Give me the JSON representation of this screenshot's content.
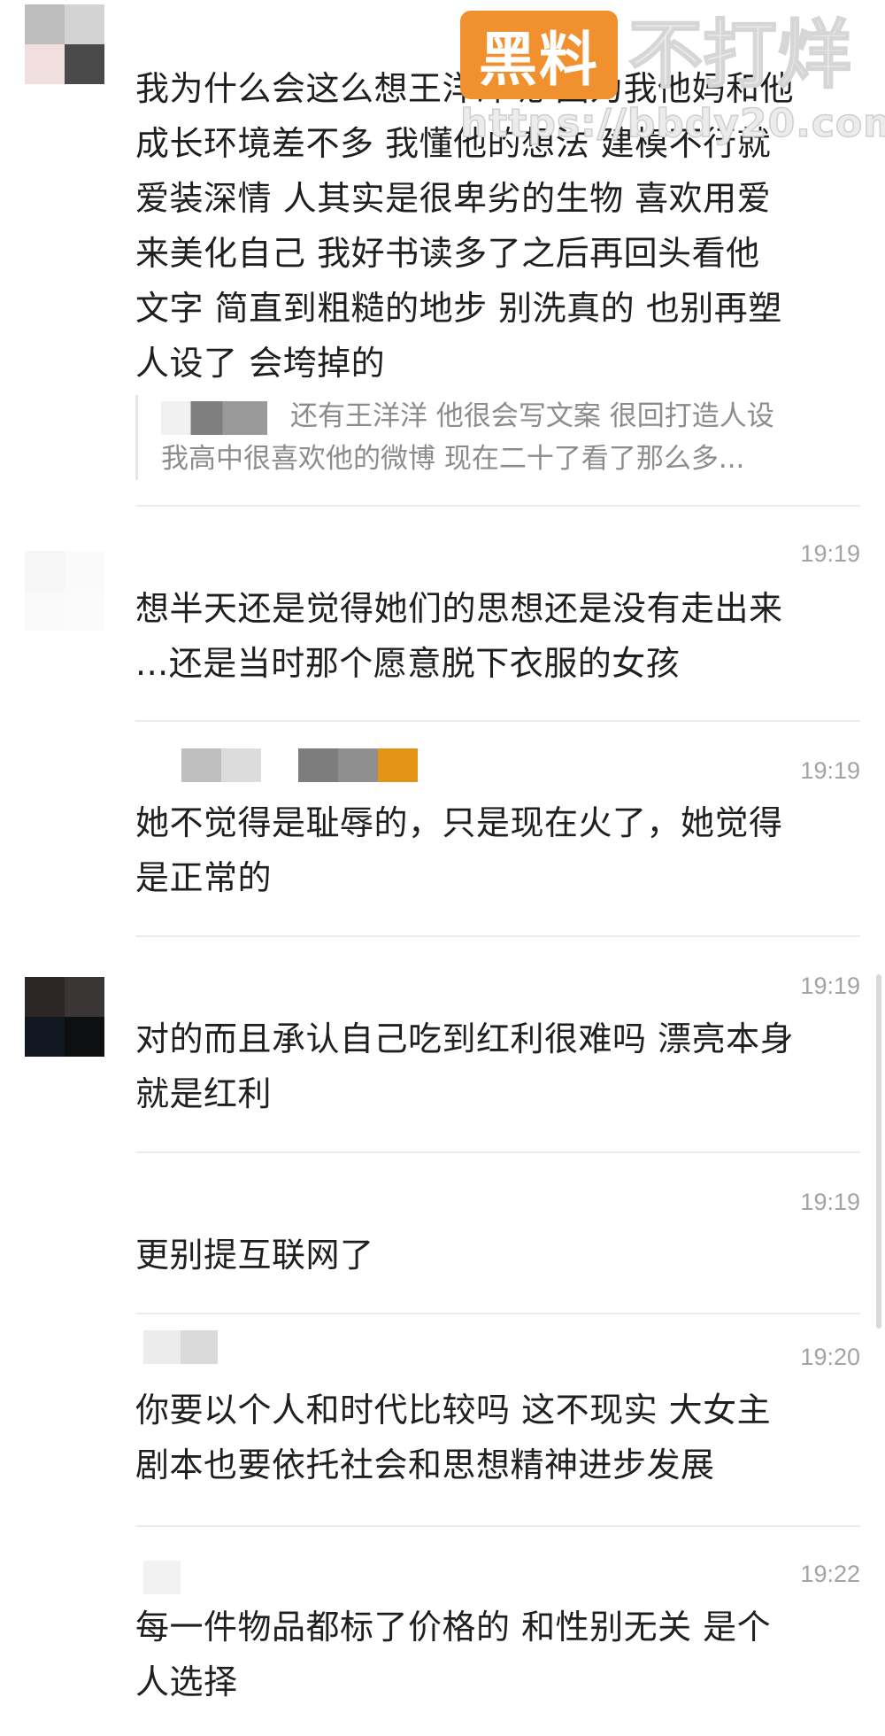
{
  "watermark": {
    "badge": "黑料",
    "title": "不打烊",
    "url": "https://bbdy20.com"
  },
  "messages": [
    {
      "time": "",
      "text": "我为什么会这么想王洋洋呢 因为我他妈和他\n成长环境差不多 我懂他的想法 建模不行就\n爱装深情 人其实是很卑劣的生物 喜欢用爱\n来美化自己 我好书读多了之后再回头看他\n文字 简直到粗糙的地步 别洗真的 也别再塑\n人设了 会垮掉的",
      "quote": "还有王洋洋 他很会写文案 很回打造人设\n我高中很喜欢他的微博 现在二十了看了那么多..."
    },
    {
      "time": "19:19",
      "text": "想半天还是觉得她们的思想还是没有走出来\n...还是当时那个愿意脱下衣服的女孩"
    },
    {
      "time": "19:19",
      "text": "她不觉得是耻辱的，只是现在火了，她觉得\n是正常的"
    },
    {
      "time": "19:19",
      "text": "对的而且承认自己吃到红利很难吗 漂亮本身\n就是红利"
    },
    {
      "time": "19:19",
      "text": "更别提互联网了"
    },
    {
      "time": "19:20",
      "text": "你要以个人和时代比较吗 这不现实 大女主\n剧本也要依托社会和思想精神进步发展"
    },
    {
      "time": "19:22",
      "text": "每一件物品都标了价格的 和性别无关 是个\n人选择"
    }
  ]
}
